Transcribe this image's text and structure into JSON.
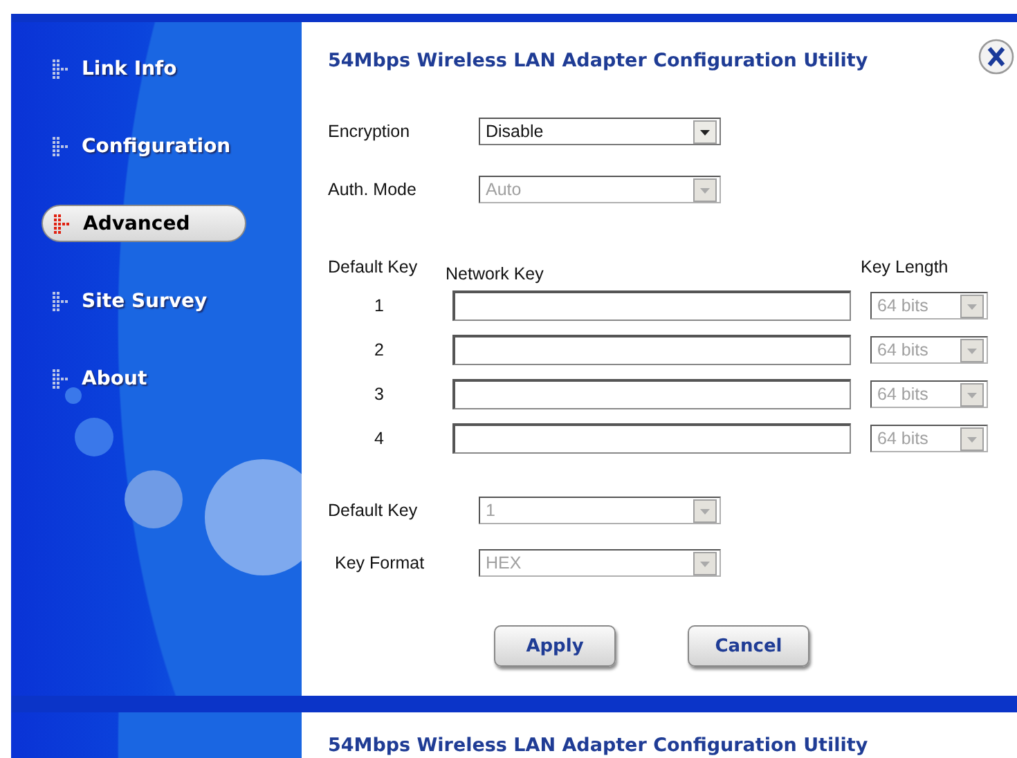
{
  "window": {
    "title": "54Mbps Wireless LAN Adapter Configuration Utility"
  },
  "sidebar": {
    "items": [
      {
        "label": "Link Info",
        "selected": false
      },
      {
        "label": "Configuration",
        "selected": false
      },
      {
        "label": "Advanced",
        "selected": true
      },
      {
        "label": "Site Survey",
        "selected": false
      },
      {
        "label": "About",
        "selected": false
      }
    ]
  },
  "settings": [
    {
      "label": "Encryption",
      "value": "Disable",
      "disabled": false
    },
    {
      "label": "Auth. Mode",
      "value": "Auto",
      "disabled": true
    }
  ],
  "keys": {
    "headers": {
      "default_key": "Default Key",
      "network_key": "Network Key",
      "key_length": "Key Length"
    },
    "rows": [
      {
        "number": "1",
        "length": "64 bits",
        "length_disabled": true
      },
      {
        "number": "2",
        "length": "64 bits",
        "length_disabled": true
      },
      {
        "number": "3",
        "length": "64 bits",
        "length_disabled": true
      },
      {
        "number": "4",
        "length": "64 bits",
        "length_disabled": true
      }
    ]
  },
  "options": [
    {
      "label": "Default Key",
      "value": "1",
      "disabled": true
    },
    {
      "label": "Key Format",
      "value": "HEX",
      "disabled": true
    }
  ],
  "buttons": [
    "Apply",
    "Cancel"
  ],
  "next_window": {
    "title": "54Mbps Wireless LAN Adapter Configuration Utility"
  }
}
